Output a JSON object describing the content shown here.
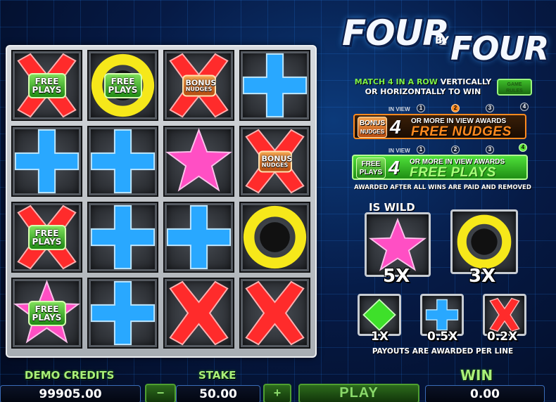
{
  "game": {
    "logo_top": "FOUR",
    "logo_by": "BY",
    "logo_bottom": "FOUR"
  },
  "reels": {
    "rows": [
      [
        {
          "symbol": "red-x",
          "badge": {
            "type": "free",
            "line1": "FREE",
            "line2": "PLAYS"
          }
        },
        {
          "symbol": "yellow-ring",
          "badge": {
            "type": "free",
            "line1": "FREE",
            "line2": "PLAYS"
          }
        },
        {
          "symbol": "red-x",
          "badge": {
            "type": "bonus",
            "line1": "BONUS",
            "line2": "NUDGES"
          }
        },
        {
          "symbol": "blue-plus",
          "badge": null
        }
      ],
      [
        {
          "symbol": "blue-plus",
          "badge": null
        },
        {
          "symbol": "blue-plus",
          "badge": null
        },
        {
          "symbol": "pink-star",
          "badge": null
        },
        {
          "symbol": "red-x",
          "badge": {
            "type": "bonus",
            "line1": "BONUS",
            "line2": "NUDGES"
          }
        }
      ],
      [
        {
          "symbol": "red-x",
          "badge": {
            "type": "free",
            "line1": "FREE",
            "line2": "PLAYS"
          }
        },
        {
          "symbol": "blue-plus",
          "badge": null
        },
        {
          "symbol": "blue-plus",
          "badge": null
        },
        {
          "symbol": "yellow-ring",
          "badge": null
        }
      ],
      [
        {
          "symbol": "pink-star",
          "badge": {
            "type": "free",
            "line1": "FREE",
            "line2": "PLAYS"
          }
        },
        {
          "symbol": "blue-plus",
          "badge": null
        },
        {
          "symbol": "red-x",
          "badge": null
        },
        {
          "symbol": "red-x",
          "badge": null
        }
      ]
    ]
  },
  "rules": {
    "line1_green": "MATCH 4 IN A ROW",
    "line1_white": "VERTICALLY",
    "line2": "OR HORIZONTALLY TO WIN",
    "info_button": "GAME RULES"
  },
  "awards": {
    "in_view_label": "IN VIEW",
    "dots": [
      "1",
      "2",
      "3",
      "4"
    ],
    "nudges": {
      "icon_line1": "BONUS",
      "icon_line2": "NUDGES",
      "count": "4",
      "small": "OR MORE IN VIEW AWARDS",
      "big_white": "FREE",
      "big_orange": "NUDGES"
    },
    "plays": {
      "icon_line1": "FREE",
      "icon_line2": "PLAYS",
      "count": "4",
      "small": "OR MORE IN VIEW AWARDS",
      "big": "FREE PLAYS"
    },
    "footnote": "AWARDED AFTER ALL WINS ARE PAID AND REMOVED"
  },
  "paytable": {
    "wild_label": "IS WILD",
    "star_mult": "5X",
    "ring_mult": "3X",
    "diamond_mult": "1X",
    "plus_mult": "0.5X",
    "x_mult": "0.2X",
    "footer": "PAYOUTS ARE AWARDED PER LINE"
  },
  "footer": {
    "credits_label": "DEMO CREDITS",
    "credits_value": "99905.00",
    "stake_label": "STAKE",
    "stake_value": "50.00",
    "minus": "−",
    "plus": "+",
    "play": "PLAY",
    "win_label": "WIN",
    "win_value": "0.00"
  },
  "colors": {
    "red_x": "#ff2b2b",
    "blue_plus": "#29a8ff",
    "pink_star": "#ff4fc4",
    "yellow_ring": "#f6e81a",
    "green_diamond": "#3ee02a"
  }
}
